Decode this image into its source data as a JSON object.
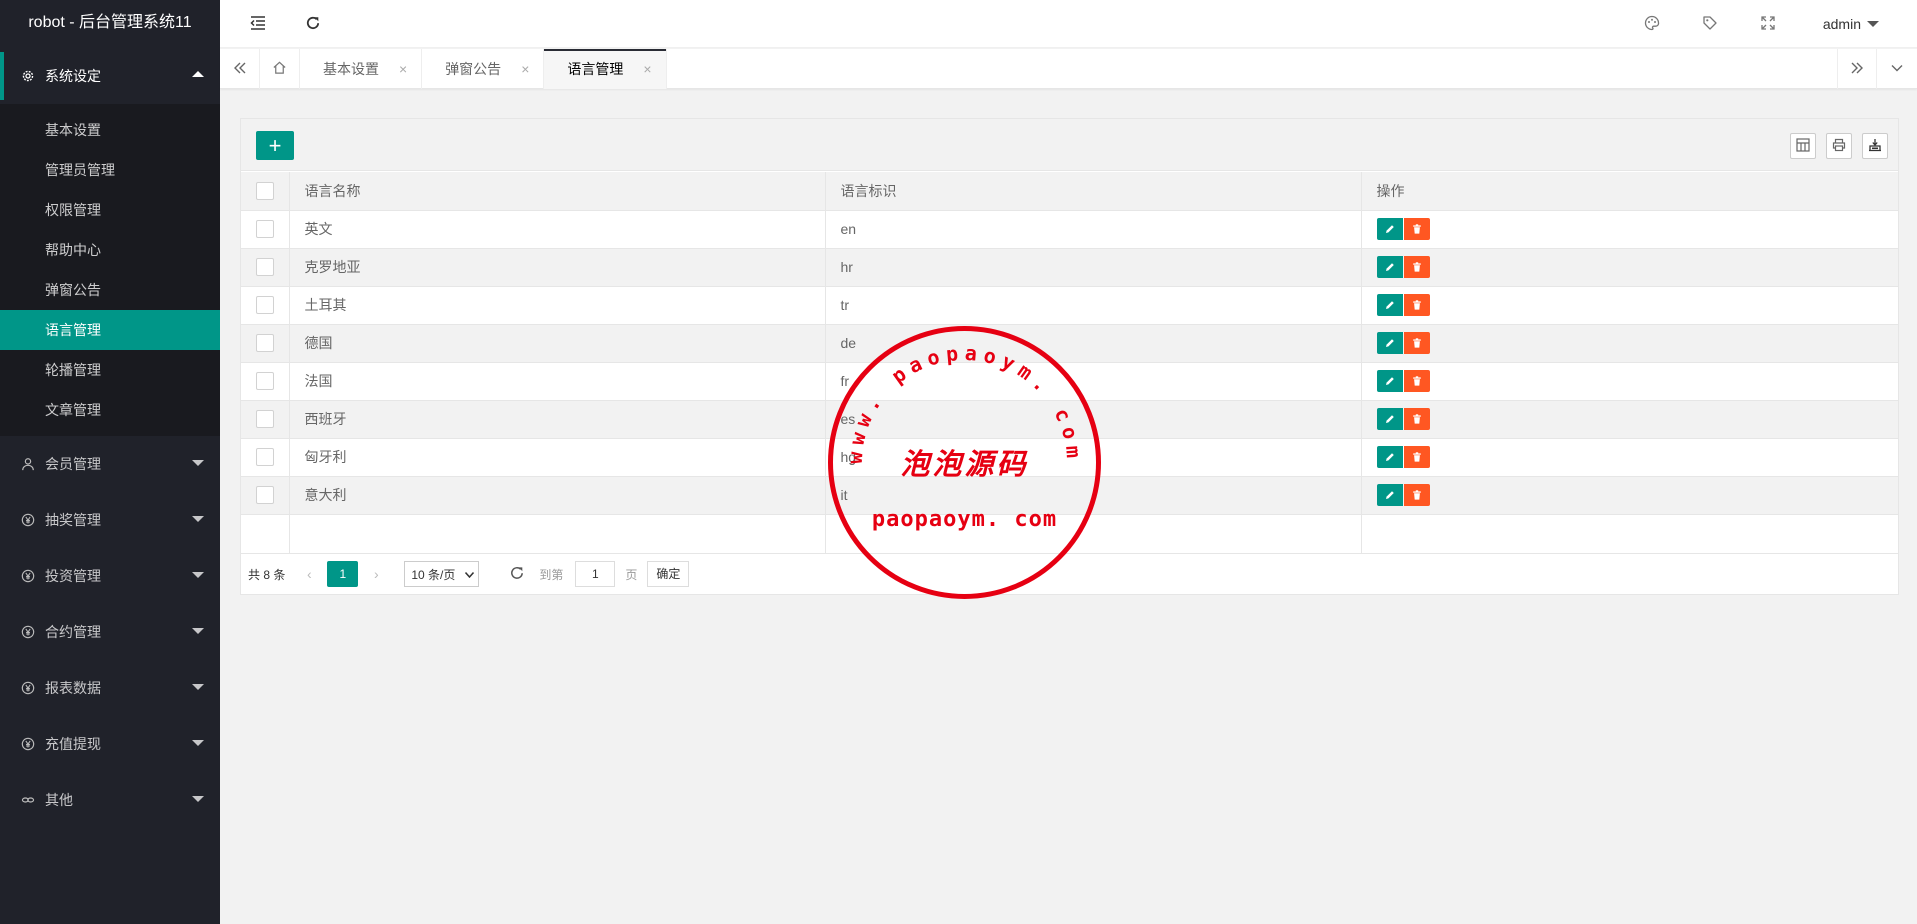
{
  "app": {
    "title": "robot - 后台管理系统11"
  },
  "sidebar": {
    "groups": [
      {
        "label": "系统设定",
        "icon": "gear-icon",
        "expanded": true,
        "items": [
          {
            "label": "基本设置",
            "active": false
          },
          {
            "label": "管理员管理",
            "active": false
          },
          {
            "label": "权限管理",
            "active": false
          },
          {
            "label": "帮助中心",
            "active": false
          },
          {
            "label": "弹窗公告",
            "active": false
          },
          {
            "label": "语言管理",
            "active": true
          },
          {
            "label": "轮播管理",
            "active": false
          },
          {
            "label": "文章管理",
            "active": false
          }
        ]
      },
      {
        "label": "会员管理",
        "icon": "user-icon"
      },
      {
        "label": "抽奖管理",
        "icon": "yen-icon"
      },
      {
        "label": "投资管理",
        "icon": "yen-icon"
      },
      {
        "label": "合约管理",
        "icon": "yen-icon"
      },
      {
        "label": "报表数据",
        "icon": "yen-icon"
      },
      {
        "label": "充值提现",
        "icon": "yen-icon"
      },
      {
        "label": "其他",
        "icon": "link-icon"
      }
    ]
  },
  "header": {
    "user": "admin"
  },
  "tabs": [
    {
      "label": "基本设置",
      "close": "×",
      "active": false
    },
    {
      "label": "弹窗公告",
      "close": "×",
      "active": false
    },
    {
      "label": "语言管理",
      "close": "×",
      "active": true
    }
  ],
  "table": {
    "add_label": "+",
    "columns": [
      "语言名称",
      "语言标识",
      "操作"
    ],
    "rows": [
      {
        "name": "英文",
        "code": "en"
      },
      {
        "name": "克罗地亚",
        "code": "hr"
      },
      {
        "name": "土耳其",
        "code": "tr"
      },
      {
        "name": "德国",
        "code": "de"
      },
      {
        "name": "法国",
        "code": "fr"
      },
      {
        "name": "西班牙",
        "code": "es"
      },
      {
        "name": "匈牙利",
        "code": "hg"
      },
      {
        "name": "意大利",
        "code": "it"
      }
    ]
  },
  "pager": {
    "total": "共 8 条",
    "current": "1",
    "page_size": "10 条/页",
    "goto_label": "到第",
    "goto_value": "1",
    "page_unit": "页",
    "confirm": "确定"
  },
  "watermark": {
    "url": "www. paopaoym. com",
    "name": "泡泡源码",
    "domain": "paopaoym. com",
    "color": "#e60012"
  },
  "colors": {
    "primary": "#009688",
    "danger": "#ff5722",
    "sidebar": "#20222a"
  }
}
